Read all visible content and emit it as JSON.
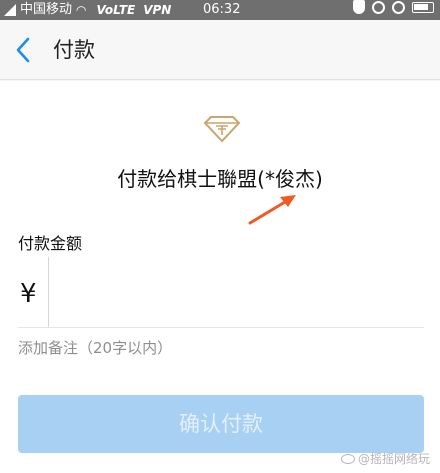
{
  "status_bar": {
    "carrier": "中国移动",
    "volte": "VoLTE",
    "vpn": "VPN",
    "time": "06:32",
    "icons": [
      "signal-icon",
      "wifi-icon",
      "shield-icon",
      "alarm-icon",
      "lock-rotation-icon",
      "battery-icon"
    ]
  },
  "header": {
    "title": "付款",
    "back_icon": "chevron-left-icon"
  },
  "main": {
    "merchant_logo": "diamond-logo",
    "payee": "付款给棋士聯盟(*俊杰)",
    "amount_label": "付款金额",
    "currency_symbol": "¥",
    "amount_value": "",
    "remark_link": "添加备注（20字以内）",
    "confirm_label": "确认付款",
    "watermark": "@摇摇网络玩"
  },
  "colors": {
    "accent": "#1b8ef2",
    "button_disabled": "#a8d0f3",
    "annotation_arrow": "#f05a24",
    "logo_gold": "#c9a66b"
  }
}
